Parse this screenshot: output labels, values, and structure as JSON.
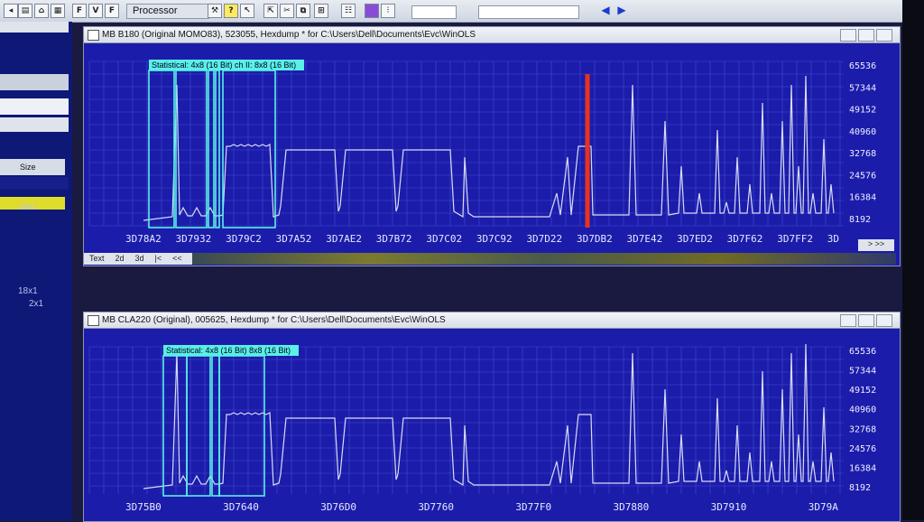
{
  "toolbar": {
    "processor_label": "Processor",
    "buttons": [
      "F",
      "V",
      "F"
    ]
  },
  "left_panel": {
    "size_header": "Size",
    "rows": [
      "18x1",
      "18x1",
      "2x1"
    ]
  },
  "window1": {
    "title": "MB B180 (Original MOMO83), 523055, Hexdump * for C:\\Users\\Dell\\Documents\\Evc\\WinOLS",
    "selection_label": "Statistical: 4x8 (16 Bit)  ch II: 8x8 (16 Bit)",
    "tabs": [
      "Text",
      "2d",
      "3d"
    ],
    "nav": [
      "|<",
      "<<",
      "<"
    ],
    "right_nav": "> >>",
    "x_ticks": [
      "3D78A2",
      "3D7932",
      "3D79C2",
      "3D7A52",
      "3D7AE2",
      "3D7B72",
      "3D7C02",
      "3D7C92",
      "3D7D22",
      "3D7DB2",
      "3D7E42",
      "3D7ED2",
      "3D7F62",
      "3D7FF2",
      "3D"
    ],
    "y_ticks": [
      "65536",
      "57344",
      "49152",
      "40960",
      "32768",
      "24576",
      "16384",
      "8192"
    ],
    "ylim": [
      0,
      65536
    ],
    "cursor_color": "#e8321e"
  },
  "window2": {
    "title": "MB CLA220 (Original), 005625, Hexdump * for C:\\Users\\Dell\\Documents\\Evc\\WinOLS",
    "selection_label": "Statistical: 4x8 (16 Bit)  8x8 (16 Bit)",
    "x_ticks": [
      "3D75B0",
      "3D7640",
      "3D76D0",
      "3D7760",
      "3D77F0",
      "3D7880",
      "3D7910",
      "3D79A"
    ],
    "y_ticks": [
      "65536",
      "57344",
      "49152",
      "40960",
      "32768",
      "24576",
      "16384",
      "8192"
    ],
    "ylim": [
      0,
      65536
    ]
  },
  "colors": {
    "plot_bg": "#1c1cab",
    "grid": "#3f4fd0",
    "line": "#d8dcf4",
    "selection": "#59f0e6"
  }
}
